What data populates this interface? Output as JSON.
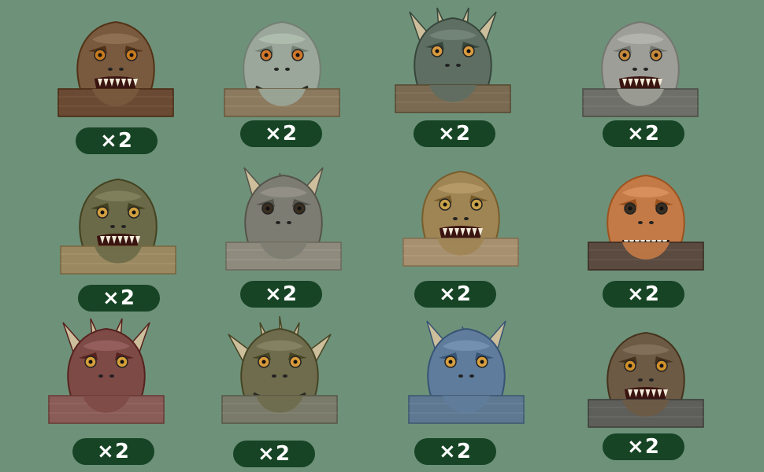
{
  "background": "#6e917a",
  "badge_color": "#164424",
  "items": [
    {
      "icon": "trex-brown-crown-icon",
      "count": "×2",
      "skin": "#7a5a3e",
      "band": "#6b4a33",
      "eye": "#c97a1e",
      "horns": 0,
      "mouth": "open"
    },
    {
      "icon": "turtle-crown-icon",
      "count": "×2",
      "skin": "#9aa79a",
      "band": "#8c7a5e",
      "eye": "#d1782b",
      "horns": 0,
      "mouth": "smile"
    },
    {
      "icon": "horned-dino-red-crown-icon",
      "count": "×2",
      "skin": "#5e6e62",
      "band": "#7a6a52",
      "eye": "#d99b40",
      "horns": 4,
      "mouth": "closed"
    },
    {
      "icon": "trex-gray-crown-icon",
      "count": "×2",
      "skin": "#9d9e97",
      "band": "#6e6f68",
      "eye": "#c98a3a",
      "horns": 0,
      "mouth": "open"
    },
    {
      "icon": "trex-green-crown-icon",
      "count": "×2",
      "skin": "#6b6a48",
      "band": "#9a8860",
      "eye": "#d2a040",
      "horns": 0,
      "mouth": "open"
    },
    {
      "icon": "triceratops-gray-crown-icon",
      "count": "×2",
      "skin": "#7d7c72",
      "band": "#8e8a7e",
      "eye": "#3a2e22",
      "horns": 3,
      "mouth": "closed"
    },
    {
      "icon": "trex-tan-crown-icon",
      "count": "×2",
      "skin": "#a08554",
      "band": "#a69070",
      "eye": "#caa24a",
      "horns": 0,
      "mouth": "open"
    },
    {
      "icon": "trex-orange-crown-icon",
      "count": "×2",
      "skin": "#c47a46",
      "band": "#5a4a40",
      "eye": "#3a2e22",
      "horns": 0,
      "mouth": "teeth"
    },
    {
      "icon": "dragon-red-crown-icon",
      "count": "×2",
      "skin": "#7e4a46",
      "band": "#8a5c58",
      "eye": "#d6a03a",
      "horns": 4,
      "mouth": "closed"
    },
    {
      "icon": "horned-dino-green-crown-icon",
      "count": "×2",
      "skin": "#6e6c4c",
      "band": "#7a7a6a",
      "eye": "#d89a3a",
      "horns": 5,
      "mouth": "smile"
    },
    {
      "icon": "triceratops-blue-crown-icon",
      "count": "×2",
      "skin": "#5f7c9c",
      "band": "#5e7892",
      "eye": "#d9a040",
      "horns": 3,
      "mouth": "closed"
    },
    {
      "icon": "raptor-brown-crown-icon",
      "count": "×2",
      "skin": "#6d5a44",
      "band": "#5e5e5a",
      "eye": "#d0902a",
      "horns": 0,
      "mouth": "open"
    }
  ]
}
